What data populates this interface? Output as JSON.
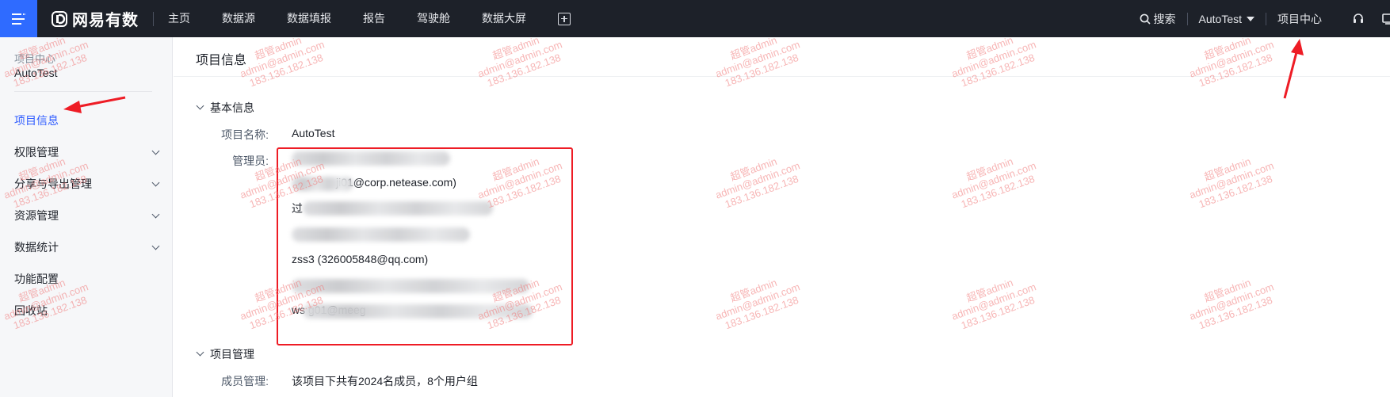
{
  "topbar": {
    "brand": "网易有数",
    "nav": [
      "主页",
      "数据源",
      "数据填报",
      "报告",
      "驾驶舱",
      "数据大屏"
    ],
    "search_label": "搜索",
    "project_selector": "AutoTest",
    "project_center": "项目中心"
  },
  "sidebar": {
    "header_label": "项目中心",
    "header_value": "AutoTest",
    "items": [
      {
        "label": "项目信息"
      },
      {
        "label": "权限管理"
      },
      {
        "label": "分享与导出管理"
      },
      {
        "label": "资源管理"
      },
      {
        "label": "数据统计"
      },
      {
        "label": "功能配置"
      },
      {
        "label": "回收站"
      }
    ]
  },
  "main": {
    "page_title": "项目信息",
    "basic_section": {
      "title": "基本信息",
      "project_name_label": "项目名称:",
      "project_name_value": "AutoTest",
      "admins_label": "管理员:",
      "admins": [
        {
          "text": ""
        },
        {
          "text": "ji01@corp.netease.com)"
        },
        {
          "text": "过"
        },
        {
          "text": ""
        },
        {
          "text": "zss3 (326005848@qq.com)"
        },
        {
          "text": ""
        },
        {
          "text": "ws                  g01@meeg"
        }
      ]
    },
    "project_section": {
      "title": "项目管理",
      "members_label": "成员管理:",
      "members_value": "该项目下共有2024名成员，8个用户组"
    }
  },
  "watermark": {
    "line1": "超管admin",
    "line2": "admin@admin.com",
    "line3": "183.136.182.138"
  },
  "colors": {
    "topbar_bg": "#1d2129",
    "accent": "#2f5cff",
    "annotation_red": "#ee1c25"
  }
}
